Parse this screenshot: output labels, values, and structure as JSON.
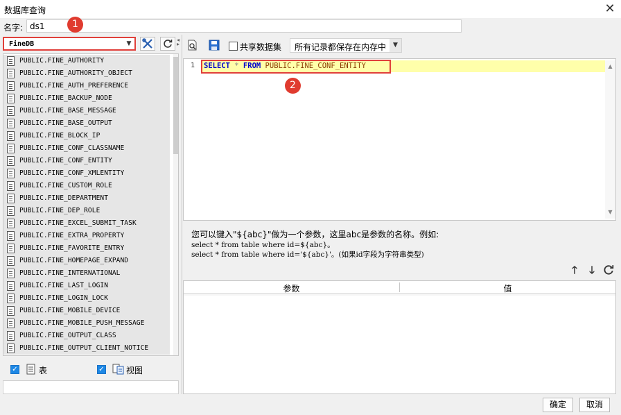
{
  "window": {
    "title": "数据库查询",
    "close_label": "✕"
  },
  "name_field": {
    "label": "名字:",
    "value": "ds1"
  },
  "annotations": {
    "badge1": "1",
    "badge2": "2"
  },
  "connection": {
    "selected": "FineDB"
  },
  "left_toolbar": {
    "edit_icon": "tools-icon",
    "refresh_icon": "refresh-icon"
  },
  "tables": [
    "PUBLIC.FINE_AUTHORITY",
    "PUBLIC.FINE_AUTHORITY_OBJECT",
    "PUBLIC.FINE_AUTH_PREFERENCE",
    "PUBLIC.FINE_BACKUP_NODE",
    "PUBLIC.FINE_BASE_MESSAGE",
    "PUBLIC.FINE_BASE_OUTPUT",
    "PUBLIC.FINE_BLOCK_IP",
    "PUBLIC.FINE_CONF_CLASSNAME",
    "PUBLIC.FINE_CONF_ENTITY",
    "PUBLIC.FINE_CONF_XMLENTITY",
    "PUBLIC.FINE_CUSTOM_ROLE",
    "PUBLIC.FINE_DEPARTMENT",
    "PUBLIC.FINE_DEP_ROLE",
    "PUBLIC.FINE_EXCEL_SUBMIT_TASK",
    "PUBLIC.FINE_EXTRA_PROPERTY",
    "PUBLIC.FINE_FAVORITE_ENTRY",
    "PUBLIC.FINE_HOMEPAGE_EXPAND",
    "PUBLIC.FINE_INTERNATIONAL",
    "PUBLIC.FINE_LAST_LOGIN",
    "PUBLIC.FINE_LOGIN_LOCK",
    "PUBLIC.FINE_MOBILE_DEVICE",
    "PUBLIC.FINE_MOBILE_PUSH_MESSAGE",
    "PUBLIC.FINE_OUTPUT_CLASS",
    "PUBLIC.FINE_OUTPUT_CLIENT_NOTICE"
  ],
  "filters": {
    "table_label": "表",
    "view_label": "视图",
    "table_checked": true,
    "view_checked": true
  },
  "right_toolbar": {
    "preview_icon": "preview-icon",
    "save_icon": "save-icon",
    "share_label": "共享数据集",
    "share_checked": false,
    "memory_option": "所有记录都保存在内存中"
  },
  "editor": {
    "line_number": "1",
    "sql": {
      "select": "SELECT",
      "star": "*",
      "from": "FROM",
      "entity": "PUBLIC.FINE_CONF_ENTITY"
    }
  },
  "hint": {
    "line1": "您可以键入\"${abc}\"做为一个参数，这里abc是参数的名称。例如:",
    "line2": "select * from table where id=${abc}。",
    "line3": "select * from table where id='${abc}'。(如果id字段为字符串类型)"
  },
  "params": {
    "header_param": "参数",
    "header_value": "值",
    "up_icon": "arrow-up-icon",
    "down_icon": "arrow-down-icon",
    "refresh_icon": "refresh-icon"
  },
  "footer": {
    "ok": "确定",
    "cancel": "取消"
  }
}
